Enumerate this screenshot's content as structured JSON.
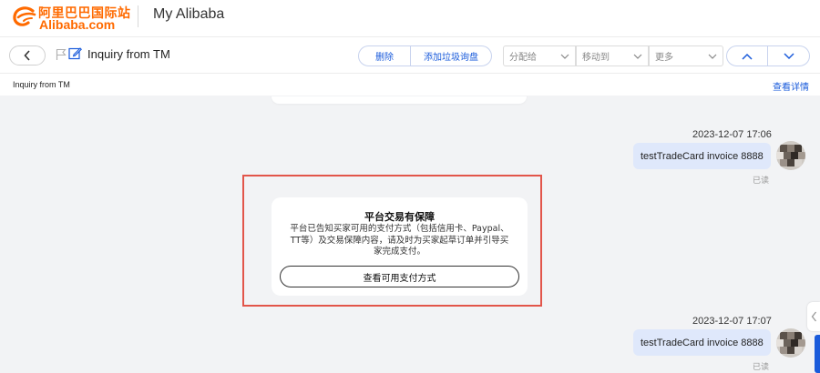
{
  "header": {
    "logo_cn": "阿里巴巴国际站",
    "logo_en": "Alibaba.com",
    "app_title": "My Alibaba"
  },
  "toolbar": {
    "thread_title": "Inquiry from TM",
    "delete_label": "删除",
    "spam_label": "添加垃圾询盘",
    "assign_label": "分配给",
    "move_label": "移动到",
    "more_label": "更多"
  },
  "subbar": {
    "left_text": "Inquiry from TM",
    "detail_link": "查看详情"
  },
  "messages": [
    {
      "time": "2023-12-07 17:06",
      "text": "testTradeCard invoice 8888",
      "status": "已读"
    },
    {
      "time": "2023-12-07 17:07",
      "text": "testTradeCard invoice 8888",
      "status": "已读"
    }
  ],
  "notice": {
    "title": "平台交易有保障",
    "line1": "平台已告知买家可用的支付方式（包括信用卡、Paypal、",
    "line2": "TT等）及交易保障内容，请及时为买家起草订单并引导买",
    "line3": "家完成支付。",
    "button": "查看可用支付方式"
  },
  "colors": {
    "brand": "#ff6a00",
    "link": "#1a5bdb",
    "bubble": "#dfe8fb",
    "highlight": "#e2554a"
  }
}
